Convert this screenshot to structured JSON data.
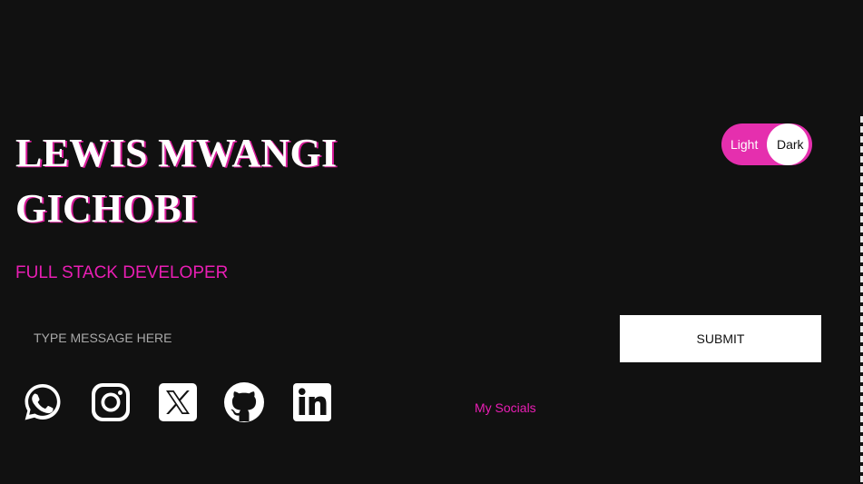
{
  "profile": {
    "name_line1": "LEWIS MWANGI",
    "name_line2": "GICHOBI",
    "role": "FULL STACK DEVELOPER"
  },
  "theme_toggle": {
    "light_label": "Light",
    "dark_label": "Dark",
    "selected": "Dark"
  },
  "contact": {
    "placeholder": "TYPE MESSAGE HERE",
    "value": "",
    "submit_label": "SUBMIT"
  },
  "socials": {
    "label": "My Socials",
    "icons": [
      "whatsapp-icon",
      "instagram-icon",
      "x-icon",
      "github-icon",
      "linkedin-icon"
    ]
  },
  "colors": {
    "background": "#111111",
    "accent": "#e91eb4",
    "text": "#ffffff"
  }
}
